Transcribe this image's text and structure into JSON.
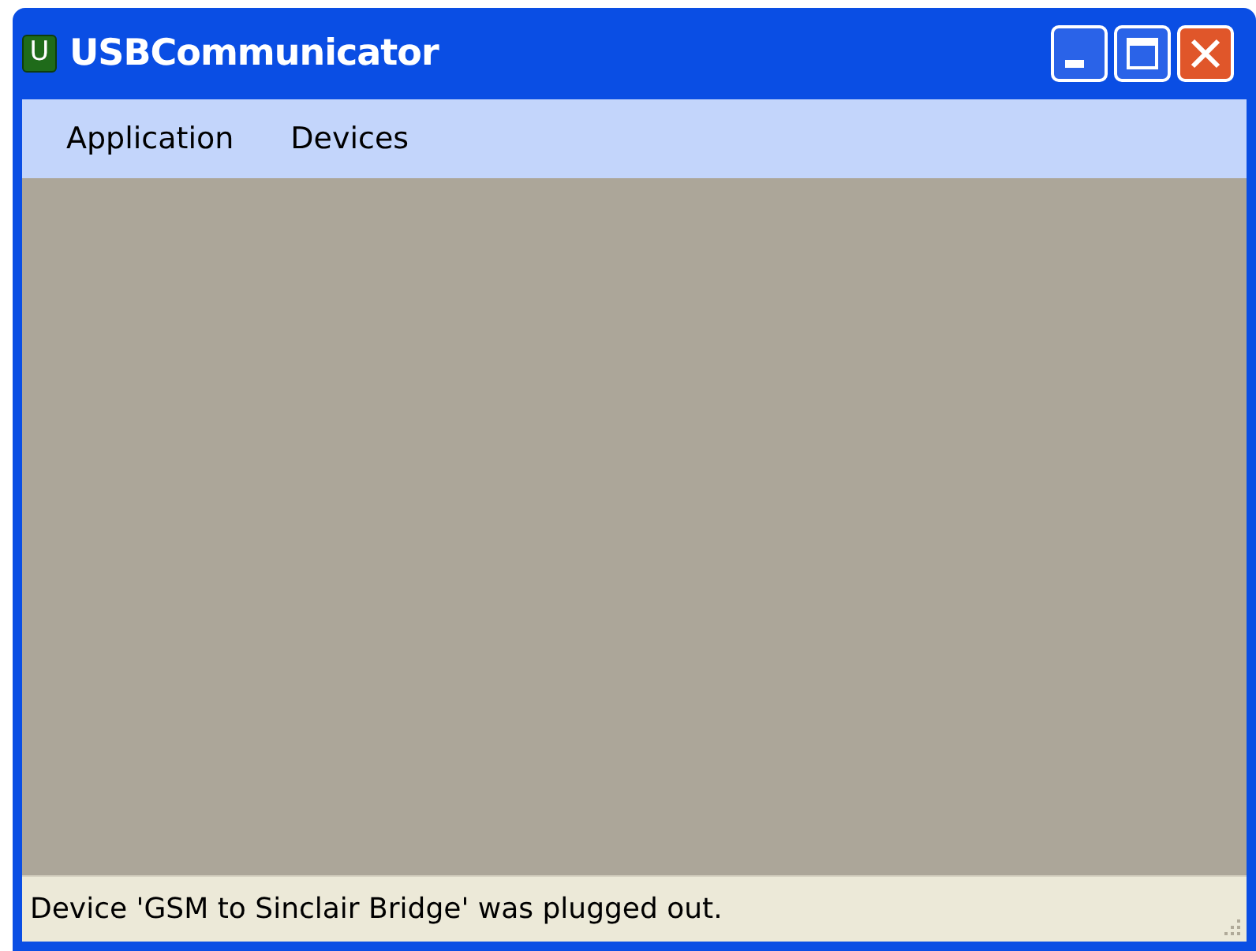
{
  "window": {
    "icon_letter": "U",
    "title": "USBCommunicator"
  },
  "menu": [
    {
      "label": "Application"
    },
    {
      "label": "Devices"
    }
  ],
  "status_bar": {
    "text": "Device 'GSM to Sinclair Bridge' was plugged out."
  }
}
